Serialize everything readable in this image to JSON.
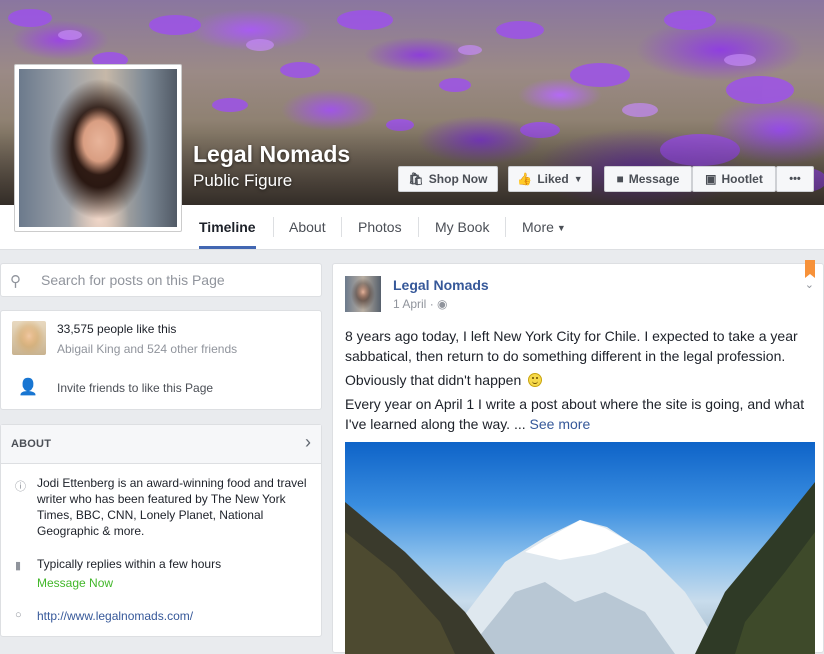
{
  "page": {
    "name": "Legal Nomads",
    "category": "Public Figure"
  },
  "cover_buttons": {
    "shop_now": "Shop Now",
    "liked": "Liked",
    "message": "Message",
    "hootlet": "Hootlet",
    "more": "•••"
  },
  "tabs": [
    {
      "label": "Timeline",
      "active": true
    },
    {
      "label": "About"
    },
    {
      "label": "Photos"
    },
    {
      "label": "My Book"
    },
    {
      "label": "More"
    }
  ],
  "search": {
    "placeholder": "Search for posts on this Page",
    "value": ""
  },
  "likes": {
    "count_text": "33,575 people like this",
    "friends_text": "Abigail King and 524 other friends",
    "invite_text": "Invite friends to like this Page"
  },
  "about": {
    "title": "ABOUT",
    "description": "Jodi Ettenberg is an award-winning food and travel writer who has been featured by The New York Times, BBC, CNN, Lonely Planet, National Geographic & more.",
    "reply_time": "Typically replies within a few hours",
    "message_now": "Message Now",
    "website": "http://www.legalnomads.com/"
  },
  "post": {
    "author": "Legal Nomads",
    "date": "1 April",
    "paragraph1": "8 years ago today, I left New York City for Chile. I expected to take a year sabbatical, then return to do something different in the legal profession.",
    "paragraph2": "Obviously that didn't happen",
    "paragraph3": "Every year on April 1 I write a post about where the site is going, and what I've learned along the way. ...",
    "see_more": "See more"
  },
  "colors": {
    "link_blue": "#365899",
    "accent_blue": "#4267b2",
    "green": "#42b72a",
    "background": "#e9ebee"
  }
}
